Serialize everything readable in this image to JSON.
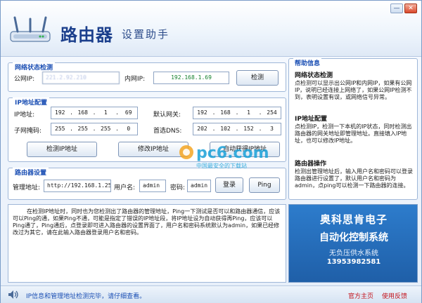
{
  "window": {
    "title_main": "路由器",
    "title_sub": "设置助手",
    "minimize_icon": "minimize-icon",
    "close_label": "✕"
  },
  "network_status": {
    "title": "网络状态检测",
    "public_ip_label": "公网IP:",
    "public_ip_value": "221.2.92.210",
    "private_ip_label": "内网IP:",
    "private_ip_value": "192.168.1.69",
    "detect_button": "检测"
  },
  "ip_config": {
    "title": "IP地址配置",
    "ip_label": "IP地址:",
    "ip_octets": [
      "192",
      "168",
      "1",
      "69"
    ],
    "gateway_label": "默认网关:",
    "gateway_octets": [
      "192",
      "168",
      "1",
      "254"
    ],
    "mask_label": "子网掩码:",
    "mask_octets": [
      "255",
      "255",
      "255",
      "0"
    ],
    "dns_label": "首选DNS:",
    "dns_octets": [
      "202",
      "102",
      "152",
      "3"
    ],
    "check_ip_button": "检测IP地址",
    "modify_ip_button": "修改IP地址",
    "auto_ip_button": "自动获得IP地址"
  },
  "router_settings": {
    "title": "路由器设置",
    "admin_addr_label": "管理地址:",
    "admin_addr_value": "http://192.168.1.254",
    "username_label": "用户名:",
    "username_value": "admin",
    "password_label": "密码:",
    "password_value": "admin",
    "login_button": "登录",
    "ping_button": "Ping"
  },
  "help": {
    "title": "帮助信息",
    "s1_title": "网络状态检测",
    "s1_text": "点检测可以显示出公网IP和内网IP，如果有公网IP，说明已经连接上网络了，如果公网IP检测不到，表明设置有误，或网络信号异常。",
    "s2_title": "IP地址配置",
    "s2_text": "点检测IP，检测一下本机的IP状态，同时检测出路由器的网关地址即管理地址。直接填入IP地址，也可以修改IP地址。",
    "s3_title": "路由器操作",
    "s3_text": "检测出管理地址后，输入用户名和密码可以登录路由器进行设置了，默认用户名和密码为admin，点ping可以检测一下路由器的连接。"
  },
  "log_text": "在检测IP地址时，同时也为您检测出了路由器的管理地址，Ping一下测试是否可以和路由器通信，应该可以Ping的通，如果Ping不通，可能是指定了错误的IP地址段，将IP地址设为自动获得再Ping，应该可以Ping通了，Ping通后，点登录即可进入路由器的设置界面了，用户名和密码系统默认为admin，如果已经修改过为其它，请在此输入路由器登录用户名和密码。",
  "ad": {
    "line1": "奥科思肯电子",
    "line2": "自动化控制系统",
    "line3": "无负压供水系统",
    "line4": "13953982581"
  },
  "watermark": {
    "brand": "pc6.com",
    "tagline": "中国最安全的下载站"
  },
  "statusbar": {
    "message": "IP信息和管理地址检测完毕，请仔细查看。",
    "home_link": "官方主页",
    "feedback_link": "使用反馈"
  },
  "colors": {
    "accent": "#1b4fb4",
    "green_value": "#14802c",
    "link_red": "#c4131c",
    "ad_bg": "#2d7ccc"
  }
}
